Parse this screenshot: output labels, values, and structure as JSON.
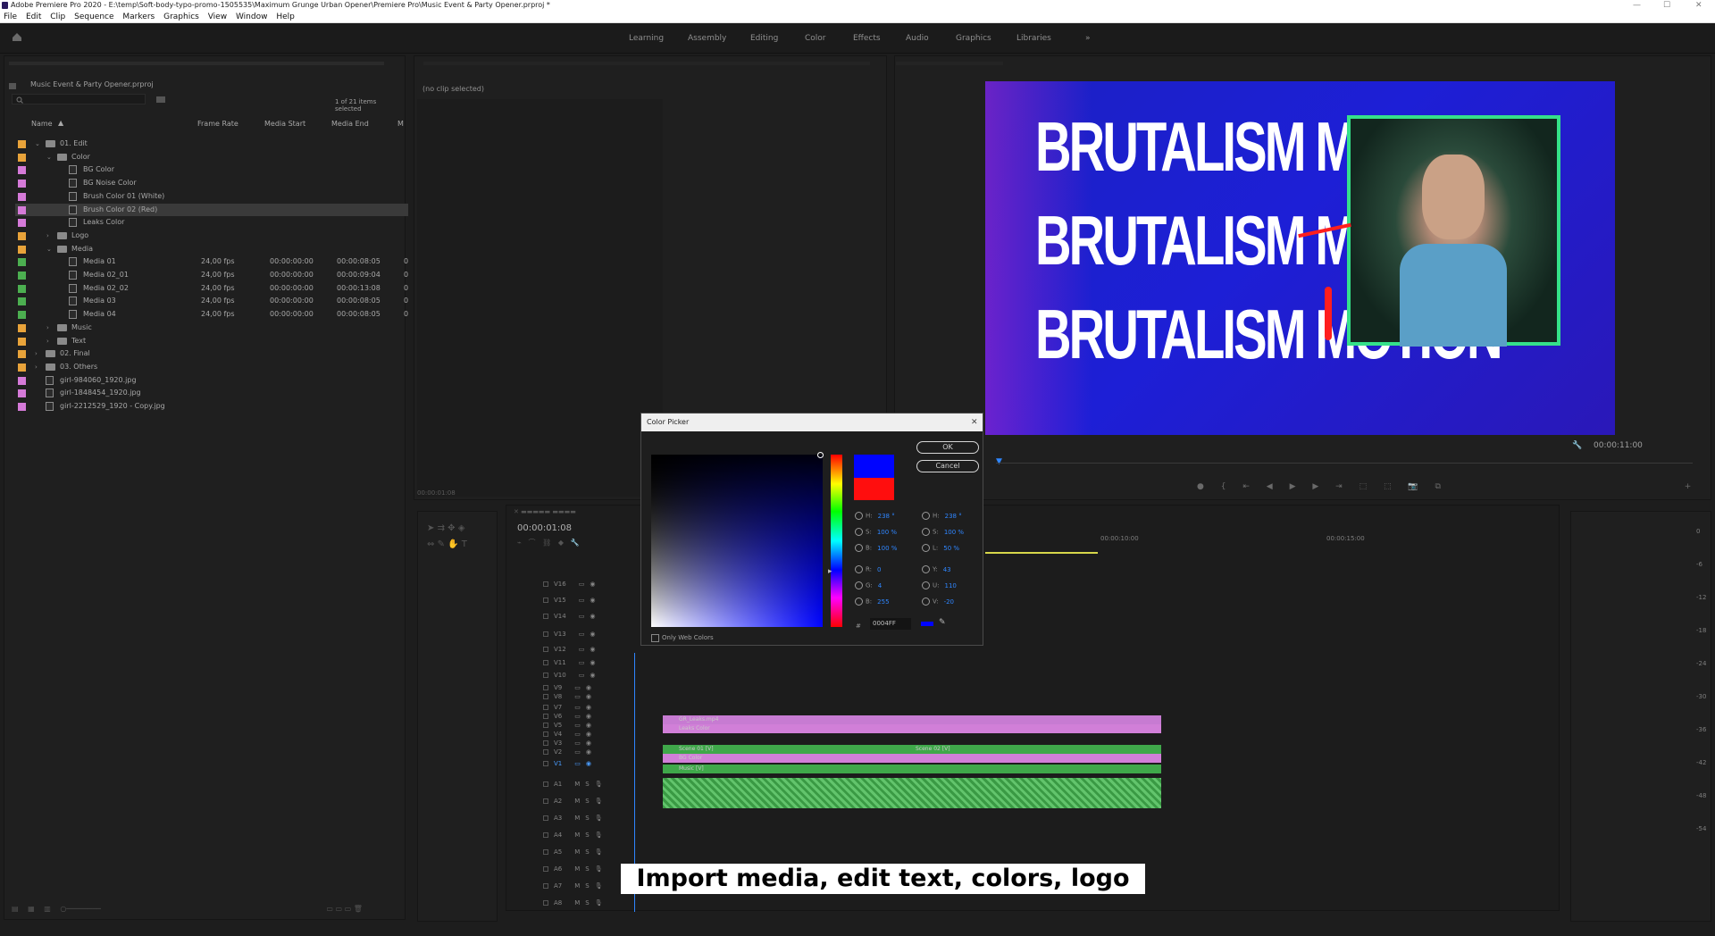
{
  "window": {
    "title": "Adobe Premiere Pro 2020 - E:\\temp\\Soft-body-typo-promo-1505535\\Maximum Grunge Urban Opener\\Premiere Pro\\Music Event & Party Opener.prproj *"
  },
  "menu": [
    "File",
    "Edit",
    "Clip",
    "Sequence",
    "Markers",
    "Graphics",
    "View",
    "Window",
    "Help"
  ],
  "workspaces": [
    "Learning",
    "Assembly",
    "Editing",
    "Color",
    "Effects",
    "Audio",
    "Graphics",
    "Libraries"
  ],
  "project": {
    "name": "Music Event & Party Opener.prproj",
    "items_selected": "1 of 21 items selected",
    "columns": [
      "Name",
      "Frame Rate",
      "Media Start",
      "Media End",
      "M"
    ],
    "rows": [
      {
        "name": "01. Edit",
        "rate": "",
        "start": "",
        "end": "",
        "m": ""
      },
      {
        "name": "Color",
        "rate": "",
        "start": "",
        "end": "",
        "m": ""
      },
      {
        "name": "BG Color",
        "rate": "",
        "start": "",
        "end": "",
        "m": ""
      },
      {
        "name": "BG Noise Color",
        "rate": "",
        "start": "",
        "end": "",
        "m": ""
      },
      {
        "name": "Brush Color 01 (White)",
        "rate": "",
        "start": "",
        "end": "",
        "m": ""
      },
      {
        "name": "Brush Color 02 (Red)",
        "rate": "",
        "start": "",
        "end": "",
        "m": ""
      },
      {
        "name": "Leaks Color",
        "rate": "",
        "start": "",
        "end": "",
        "m": ""
      },
      {
        "name": "Logo",
        "rate": "",
        "start": "",
        "end": "",
        "m": ""
      },
      {
        "name": "Media",
        "rate": "",
        "start": "",
        "end": "",
        "m": ""
      },
      {
        "name": "Media 01",
        "rate": "24,00 fps",
        "start": "00:00:00:00",
        "end": "00:00:08:05",
        "m": "0"
      },
      {
        "name": "Media 02_01",
        "rate": "24,00 fps",
        "start": "00:00:00:00",
        "end": "00:00:09:04",
        "m": "0"
      },
      {
        "name": "Media 02_02",
        "rate": "24,00 fps",
        "start": "00:00:00:00",
        "end": "00:00:13:08",
        "m": "0"
      },
      {
        "name": "Media 03",
        "rate": "24,00 fps",
        "start": "00:00:00:00",
        "end": "00:00:08:05",
        "m": "0"
      },
      {
        "name": "Media 04",
        "rate": "24,00 fps",
        "start": "00:00:00:00",
        "end": "00:00:08:05",
        "m": "0"
      },
      {
        "name": "Music",
        "rate": "",
        "start": "",
        "end": "",
        "m": ""
      },
      {
        "name": "Text",
        "rate": "",
        "start": "",
        "end": "",
        "m": ""
      },
      {
        "name": "02. Final",
        "rate": "",
        "start": "",
        "end": "",
        "m": ""
      },
      {
        "name": "03. Others",
        "rate": "",
        "start": "",
        "end": "",
        "m": ""
      },
      {
        "name": "girl-984060_1920.jpg",
        "rate": "",
        "start": "",
        "end": "",
        "m": ""
      },
      {
        "name": "girl-1848454_1920.jpg",
        "rate": "",
        "start": "",
        "end": "",
        "m": ""
      },
      {
        "name": "girl-2212529_1920 - Copy.jpg",
        "rate": "",
        "start": "",
        "end": "",
        "m": ""
      }
    ]
  },
  "effect_controls": {
    "no_clip": "(no clip selected)",
    "timecode": "00:00:01:08"
  },
  "program": {
    "headline": "BRUTALISM MOTION",
    "duration": "00:00:11:00"
  },
  "color_picker": {
    "title": "Color Picker",
    "ok": "OK",
    "cancel": "Cancel",
    "only_web_colors": "Only Web Colors",
    "hex_label": "#",
    "hex": "0004FF",
    "fields_left": [
      {
        "label": "H:",
        "value": "238 °"
      },
      {
        "label": "S:",
        "value": "100 %"
      },
      {
        "label": "B:",
        "value": "100 %"
      },
      {
        "label": "R:",
        "value": "0"
      },
      {
        "label": "G:",
        "value": "4"
      },
      {
        "label": "B:",
        "value": "255"
      }
    ],
    "fields_right": [
      {
        "label": "H:",
        "value": "238 °"
      },
      {
        "label": "S:",
        "value": "100 %"
      },
      {
        "label": "L:",
        "value": "50 %"
      },
      {
        "label": "Y:",
        "value": "43"
      },
      {
        "label": "U:",
        "value": "110"
      },
      {
        "label": "V:",
        "value": "-20"
      }
    ],
    "new_color": "#0004ff",
    "old_color": "#ff0e0e"
  },
  "timeline": {
    "timecode": "00:00:01:08",
    "ruler": [
      "00:00:10:00",
      "00:00:15:00"
    ],
    "video_tracks": [
      "V16",
      "V15",
      "V14",
      "V13",
      "V12",
      "V11",
      "V10",
      "V9",
      "V8",
      "V7",
      "V6",
      "V5",
      "V4",
      "V3",
      "V2",
      "V1"
    ],
    "audio_tracks": [
      "A1",
      "A2",
      "A3",
      "A4",
      "A5",
      "A6",
      "A7",
      "A8"
    ],
    "clips": {
      "leaks_track": "GR_Leaks.mp4",
      "leaks_color": "Leaks Color",
      "scene1": "Scene 01 [V]",
      "scene2": "Scene 02 [V]",
      "bg_color": "BG Color",
      "music": "Music [V]"
    }
  },
  "meters": [
    "0",
    "-6",
    "-12",
    "-18",
    "-24",
    "-30",
    "-36",
    "-42",
    "-48",
    "-54"
  ],
  "caption": "Import media, edit text, colors, logo",
  "colors": {
    "accent": "#2f86ff",
    "orange": "#e8a33a",
    "pink": "#d57ad8",
    "green": "#4caf50"
  }
}
